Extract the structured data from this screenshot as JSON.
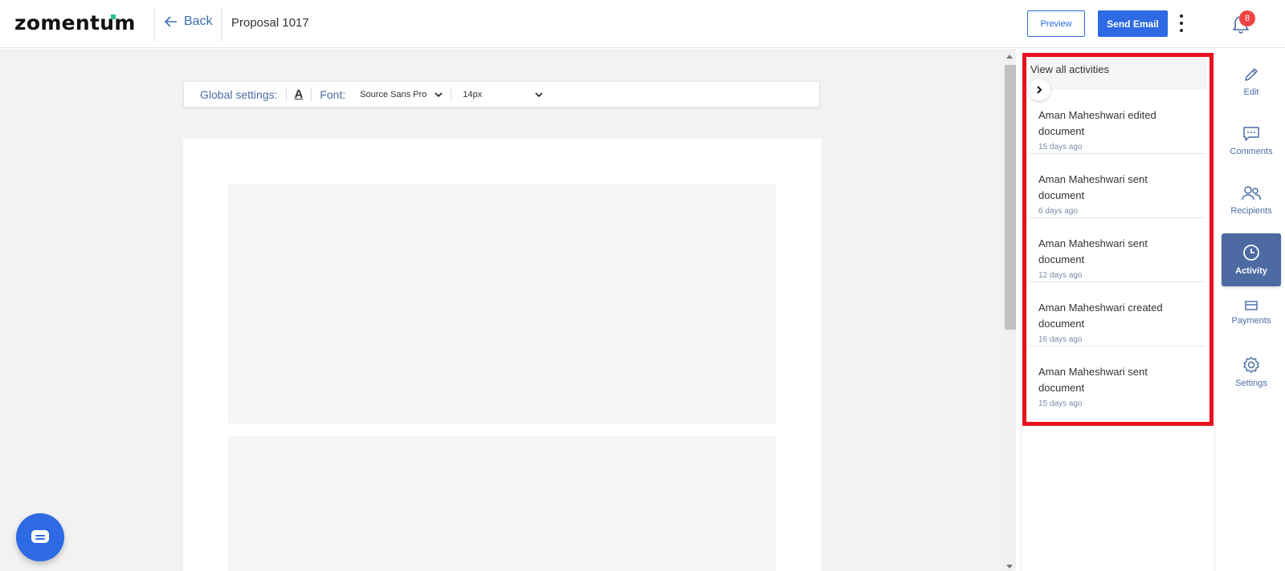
{
  "header": {
    "logo": "zomentum",
    "back_label": "Back",
    "document_title": "Proposal 1017",
    "preview_label": "Preview",
    "send_label": "Send Email",
    "notification_count": "8"
  },
  "toolbar": {
    "global_settings_label": "Global settings:",
    "font_label": "Font:",
    "font_value": "Source Sans Pro",
    "size_value": "14px"
  },
  "activity": {
    "view_all_label": "View all activities",
    "items": [
      {
        "text": "Aman Maheshwari edited document",
        "time": "15 days ago"
      },
      {
        "text": "Aman Maheshwari sent document",
        "time": "6 days ago"
      },
      {
        "text": "Aman Maheshwari sent document",
        "time": "12 days ago"
      },
      {
        "text": "Aman Maheshwari created document",
        "time": "16 days ago"
      },
      {
        "text": "Aman Maheshwari sent document",
        "time": "15 days ago"
      }
    ]
  },
  "sidebar": {
    "items": [
      {
        "label": "Edit",
        "icon": "pencil-icon"
      },
      {
        "label": "Comments",
        "icon": "comment-icon"
      },
      {
        "label": "Recipients",
        "icon": "users-icon"
      },
      {
        "label": "Activity",
        "icon": "clock-icon",
        "active": true
      },
      {
        "label": "Payments",
        "icon": "card-icon"
      },
      {
        "label": "Settings",
        "icon": "gear-icon"
      }
    ]
  },
  "colors": {
    "accent": "#2d6ae3",
    "highlight": "#e8101c",
    "sidebar_active": "#4d6aa3"
  }
}
